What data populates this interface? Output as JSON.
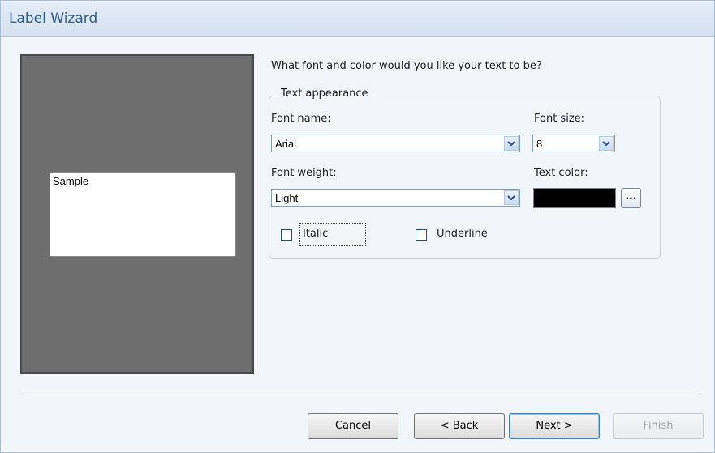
{
  "window": {
    "title": "Label Wizard"
  },
  "preview": {
    "sample_text": "Sample"
  },
  "main": {
    "question": "What font and color would you like your text to be?",
    "group_label": "Text appearance",
    "font_name_label": "Font name:",
    "font_name_value": "Arial",
    "font_size_label": "Font size:",
    "font_size_value": "8",
    "font_weight_label": "Font weight:",
    "font_weight_value": "Light",
    "text_color_label": "Text color:",
    "text_color_value": "#000000",
    "ellipsis_label": "...",
    "italic_label": "Italic",
    "italic_checked": false,
    "underline_label": "Underline",
    "underline_checked": false
  },
  "footer": {
    "cancel_label": "Cancel",
    "back_label": "< Back",
    "next_label": "Next >",
    "finish_label": "Finish"
  }
}
